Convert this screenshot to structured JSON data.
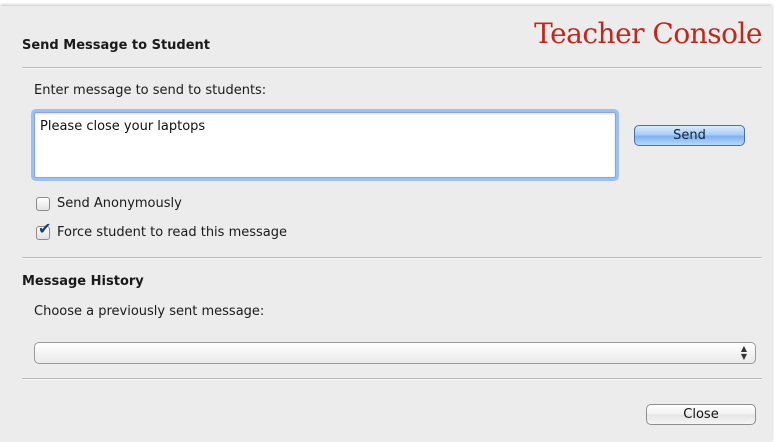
{
  "brand": "Teacher Console",
  "send_section": {
    "title": "Send Message to Student",
    "prompt": "Enter message to send to students:",
    "message_value": "Please close your laptops",
    "send_label": "Send",
    "options": [
      {
        "label": "Send Anonymously",
        "checked": false
      },
      {
        "label": "Force student to read this message",
        "checked": true
      }
    ]
  },
  "history_section": {
    "title": "Message History",
    "prompt": "Choose a previously sent message:",
    "selected_value": ""
  },
  "footer": {
    "close_label": "Close"
  }
}
